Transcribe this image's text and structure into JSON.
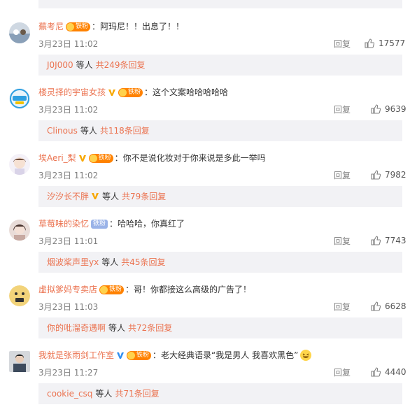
{
  "ui": {
    "reply_label": "回复",
    "others_label": "等人"
  },
  "comments": [
    {
      "username": "蕪考尼",
      "has_v": false,
      "fan_badge": "铁粉",
      "text": "：阿玛尼！！出息了！！",
      "time": "3月23日 11:02",
      "likes": "17577",
      "sub_user": "J0J000",
      "sub_total": "共249条回复",
      "avatar_color": "#8aa0b8"
    },
    {
      "username": "楼灵择的宇宙女孩",
      "has_v": true,
      "fan_badge": "铁粉",
      "text": "：这个文案哈哈哈哈哈",
      "time": "3月23日 11:02",
      "likes": "9639",
      "sub_user": "Clinous",
      "sub_total": "共118条回复",
      "avatar_color": "#2e9fe0"
    },
    {
      "username": "埃Aeri_梨",
      "has_v": true,
      "fan_badge": "铁粉",
      "text": "：你不是说化妆对于你来说是多此一举吗",
      "time": "3月23日 11:02",
      "likes": "7982",
      "sub_user": "汐汐长不胖",
      "sub_user_v": true,
      "sub_total": "共79条回复",
      "avatar_color": "#d9d3e8"
    },
    {
      "username": "草莓味的染忆",
      "has_v": false,
      "fan_badge_alt": "铁粉",
      "text": "：哈哈哈，你真红了",
      "time": "3月23日 11:01",
      "likes": "7743",
      "sub_user": "烟波桨声里yx",
      "sub_total": "共45条回复",
      "avatar_color": "#c7a9a1"
    },
    {
      "username": "虚拟爹妈专卖店",
      "has_v": false,
      "fan_badge": "铁粉",
      "text": "：哥！你都接这么高级的广告了！",
      "time": "3月23日 11:03",
      "likes": "6628",
      "sub_user": "你的吡溜奇遇啊",
      "sub_total": "共72条回复",
      "avatar_color": "#f2d37a"
    },
    {
      "username": "我就是张雨剑工作室",
      "has_v": true,
      "v_color": "#2f8ef0",
      "fan_badge": "铁粉",
      "text": "：老大经典语录“我是男人 我喜欢黑色”",
      "emoji": "laughing-emoji",
      "time": "3月23日 11:27",
      "likes": "4440",
      "sub_user": "cookie_csq",
      "sub_total": "共71条回复",
      "avatar_color": "#3d4a5c"
    }
  ]
}
